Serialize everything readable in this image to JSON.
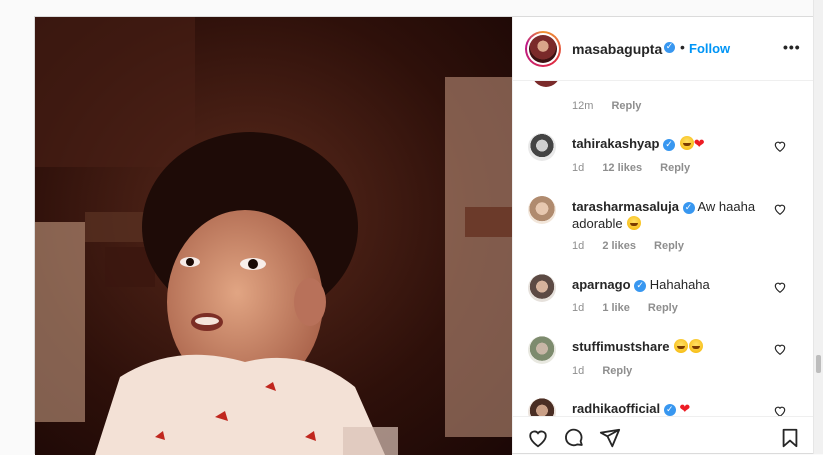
{
  "post": {
    "owner": {
      "username": "masabagupta",
      "dot": "•",
      "follow_label": "Follow",
      "more_label": "•••"
    },
    "top_comment_meta": {
      "time": "12m",
      "reply": "Reply"
    },
    "comments": [
      {
        "username": "tahirakashyap",
        "text": "",
        "emojis": [
          "grinning-emoji",
          "red-heart"
        ],
        "time": "1d",
        "likes": "12 likes",
        "reply": "Reply"
      },
      {
        "username": "tarasharmasaluja",
        "text": "Aw haaha adorable",
        "emojis": [
          "kissing-emoji"
        ],
        "time": "1d",
        "likes": "2 likes",
        "reply": "Reply"
      },
      {
        "username": "aparnago",
        "text": "Hahahaha",
        "emojis": [],
        "time": "1d",
        "likes": "1 like",
        "reply": "Reply"
      },
      {
        "username": "stuffimustshare",
        "text": "",
        "emojis": [
          "laughing-emoji",
          "laughing-emoji"
        ],
        "time": "1d",
        "likes": "",
        "reply": "Reply"
      },
      {
        "username": "radhikaofficial",
        "text": "",
        "emojis": [
          "red-heart"
        ],
        "time": "",
        "likes": "",
        "reply": ""
      }
    ],
    "actions": [
      "like-icon",
      "comment-icon",
      "share-icon",
      "save-icon"
    ],
    "colors": {
      "link": "#0095f6",
      "verified": "#3897f0",
      "heart": "#ed1c24",
      "muted": "#8e8e8e"
    },
    "heart_glyph": "❤"
  }
}
